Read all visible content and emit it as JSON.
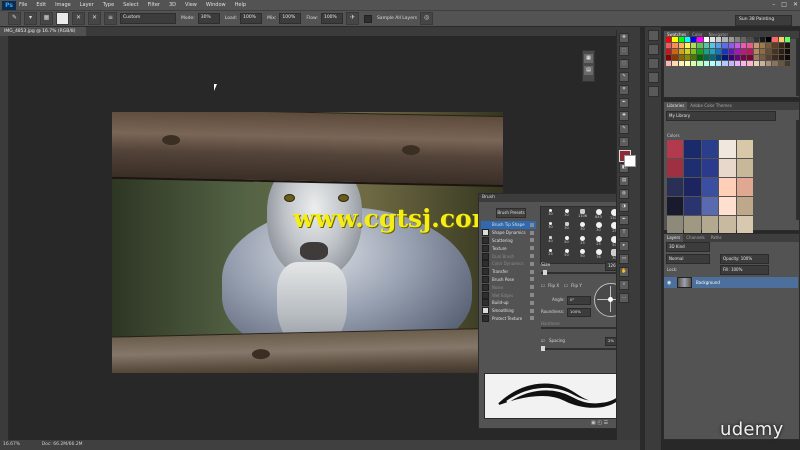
{
  "app": {
    "logo": "Ps",
    "menu": [
      "File",
      "Edit",
      "Image",
      "Layer",
      "Type",
      "Select",
      "Filter",
      "3D",
      "View",
      "Window",
      "Help"
    ],
    "window_controls": [
      "–",
      "□",
      "✕"
    ]
  },
  "options_bar": {
    "preset": "Custom",
    "mode_label": "Mode:",
    "opacity_label": "Flow:",
    "fields": [
      {
        "label": "Mode:",
        "value": "30%"
      },
      {
        "label": "Load:",
        "value": "100%"
      },
      {
        "label": "Mix:",
        "value": "100%"
      },
      {
        "label": "Flow:",
        "value": "100%"
      }
    ],
    "sample_all_layers": "Sample All Layers",
    "workspace": "Sun 38 Painting"
  },
  "document": {
    "tab": "IMG_4853.jpg @ 16.7% (RGB/8)",
    "status_zoom": "16.67%",
    "status_doc": "Doc: 66.2M/66.2M"
  },
  "watermark": "www.cgtsj.com",
  "brush_panel": {
    "title": "Brush",
    "presets_button": "Brush Presets",
    "list": [
      {
        "label": "Brush Tip Shape",
        "checked": null,
        "state": "sel"
      },
      {
        "label": "Shape Dynamics",
        "checked": true,
        "state": "normal"
      },
      {
        "label": "Scattering",
        "checked": false,
        "state": "normal"
      },
      {
        "label": "Texture",
        "checked": false,
        "state": "normal"
      },
      {
        "label": "Dual Brush",
        "checked": false,
        "state": "dim"
      },
      {
        "label": "Color Dynamics",
        "checked": false,
        "state": "dim"
      },
      {
        "label": "Transfer",
        "checked": false,
        "state": "normal"
      },
      {
        "label": "Brush Pose",
        "checked": false,
        "state": "normal"
      },
      {
        "label": "Noise",
        "checked": false,
        "state": "dim"
      },
      {
        "label": "Wet Edges",
        "checked": false,
        "state": "dim"
      },
      {
        "label": "Build-up",
        "checked": false,
        "state": "normal"
      },
      {
        "label": "Smoothing",
        "checked": true,
        "state": "normal"
      },
      {
        "label": "Protect Texture",
        "checked": false,
        "state": "normal"
      }
    ],
    "tip_sizes": [
      "30",
      "30",
      "1106",
      "843",
      "1100",
      "1100",
      "30",
      "30",
      "30",
      "30",
      "25",
      "25",
      "40",
      "50",
      "25",
      "25",
      "50",
      "71",
      "25",
      "50",
      "50",
      "36",
      "30",
      "30"
    ],
    "size_label": "Size",
    "size_value": "126 px",
    "flip_x": "Flip X",
    "flip_y": "Flip Y",
    "angle_label": "Angle:",
    "angle_value": "0°",
    "roundness_label": "Roundness:",
    "roundness_value": "100%",
    "hardness_label": "Hardness",
    "spacing_label": "Spacing",
    "spacing_value": "2%"
  },
  "swatches_panel": {
    "tabs": [
      "Swatches",
      "Color",
      "Navigator"
    ],
    "colors": [
      "#ff0000",
      "#ffff00",
      "#00ff00",
      "#00ffff",
      "#0000ff",
      "#ff00ff",
      "#ffffff",
      "#e6e6e6",
      "#cccccc",
      "#b3b3b3",
      "#999999",
      "#808080",
      "#666666",
      "#4d4d4d",
      "#333333",
      "#1a1a1a",
      "#000000",
      "#ff6666",
      "#ffcc66",
      "#66ff66",
      "#f15b5b",
      "#f58d5b",
      "#f9b55b",
      "#fff55b",
      "#b5d95b",
      "#5bc25b",
      "#5bc2a6",
      "#5bc2e8",
      "#5b9ae8",
      "#5b6ee8",
      "#8d5be8",
      "#c25be8",
      "#e85bb5",
      "#e85b8d",
      "#c79a6a",
      "#a3784a",
      "#7a5a38",
      "#5a3f22",
      "#3b2812",
      "#1d1409",
      "#d01414",
      "#d06314",
      "#d0a414",
      "#d0d014",
      "#7fc214",
      "#14a614",
      "#14a684",
      "#14a6c2",
      "#1473c2",
      "#1436c2",
      "#6314c2",
      "#a614c2",
      "#c2147f",
      "#c21463",
      "#b58a5a",
      "#8f6a42",
      "#6b4d2e",
      "#4b341c",
      "#301f0e",
      "#170d03",
      "#8a0000",
      "#8a3a00",
      "#8a6a00",
      "#8a8a00",
      "#4a7a00",
      "#006a00",
      "#006a50",
      "#006a7a",
      "#00427a",
      "#00187a",
      "#3a007a",
      "#6a007a",
      "#7a004a",
      "#7a0038",
      "#a0785a",
      "#7a5a40",
      "#5a4030",
      "#3e2a1e",
      "#26180e",
      "#120a04",
      "#ffb3b3",
      "#ffd9b3",
      "#fff0b3",
      "#ffffb3",
      "#d9ffb3",
      "#b3ffb3",
      "#b3ffe6",
      "#b3ffff",
      "#b3e6ff",
      "#b3c6ff",
      "#c6b3ff",
      "#e6b3ff",
      "#ffb3e6",
      "#ffb3cc",
      "#e6d2bc",
      "#c9b49a",
      "#a8927a",
      "#8a735c",
      "#6a5540",
      "#4a3826"
    ],
    "library_tabs": [
      "Libraries",
      "Adobe Color Themes"
    ],
    "library_name": "My Library",
    "library_section": "Colors",
    "library_colors": [
      "#b33a4d",
      "#1b2a6b",
      "#2a3e8a",
      "#f0e8df",
      "#d9c8a8",
      "#9e3042",
      "#1f2e70",
      "#2c3a8c",
      "#e8d8cc",
      "#c8b89a",
      "#2a2f55",
      "#1d2560",
      "#3a4fa0",
      "#ffcfb8",
      "#e0a890",
      "#1a1a2e",
      "#2a3470",
      "#5a6ab0",
      "#ffe0d0",
      "#bfa88a",
      "#8e8a7a",
      "#a09880",
      "#b3a890",
      "#c8baa0",
      "#d8c8b0"
    ]
  },
  "layers_panel": {
    "tabs": [
      "Layers",
      "Channels",
      "Paths"
    ],
    "kind": "3D Kind",
    "blend": "Normal",
    "opacity": "Opacity: 100%",
    "lock": "Lock:",
    "fill": "Fill: 100%",
    "layer_name": "Background"
  },
  "branding": "udemy"
}
